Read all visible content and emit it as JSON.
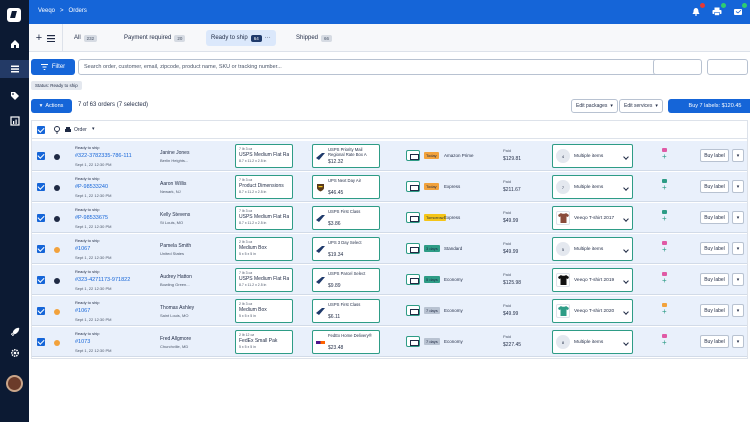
{
  "app": {
    "breadcrumb": [
      "Veeqo",
      ">",
      "Orders"
    ]
  },
  "tabs": [
    {
      "label": "All",
      "count": "232"
    },
    {
      "label": "Payment required",
      "count": "20"
    },
    {
      "label": "Ready to ship",
      "count": "64"
    },
    {
      "label": "Shipped",
      "count": "66"
    }
  ],
  "filter": {
    "button_label": "Filter",
    "search_placeholder": "Search order, customer, email, zipcode, product name, SKU or tracking number...",
    "status_chip": "Status: Ready to ship"
  },
  "actions": {
    "actions_label": "Actions",
    "selection_text": "7 of 63 orders (7 selected)",
    "edit_packages": "Edit packages",
    "edit_services": "Edit services",
    "buy_labels": "Buy 7 labels: $120.45"
  },
  "table_header": {
    "order_label": "Order"
  },
  "colors": {
    "brand": "#1565d8",
    "sidebar": "#0c1a33",
    "accent_green": "#2e9c86"
  },
  "orders": [
    {
      "status": "Ready to ship",
      "number": "#322-3782335-786-111",
      "date": "Sept 1, 22 12:30 PM",
      "channel": "amazon",
      "customer": "Janine Jones",
      "location": "Berlin Heights...",
      "pkg_weight": "7 lb 3 oz",
      "pkg_name": "USPS Medium Flat Rate...",
      "pkg_dims": "8.7 x 11.2 x 2.5 in",
      "carrier": "usps",
      "service": "USPS Priority Mail Regional Rate Box A",
      "price": "$12.32",
      "days": "Today",
      "days_color": "#f2a23c",
      "speed": "Amazon Prime",
      "paid": "Paid",
      "total": "$129.81",
      "item_thumb": "4",
      "item": "Multiple items",
      "tag1": "#e05aa5",
      "tag2": "#2e9c86",
      "buy": "Buy label"
    },
    {
      "status": "Ready to ship",
      "number": "#P-98533240",
      "date": "Sept 1, 22 12:30 PM",
      "channel": "other",
      "customer": "Aaron Willis",
      "location": "Newark, NJ",
      "pkg_weight": "7 lb 3 oz",
      "pkg_name": "Product Dimensions",
      "pkg_dims": "8.7 x 11.2 x 2.5 in",
      "carrier": "ups",
      "service": "UPS Next Day Air",
      "price": "$46.45",
      "days": "Today",
      "days_color": "#f2a23c",
      "speed": "Express",
      "paid": "Paid",
      "total": "$211.67",
      "item_thumb": "7",
      "item": "Multiple items",
      "tag1": "#2e9c86",
      "tag2": "#2e9c86",
      "buy": "Buy label"
    },
    {
      "status": "Ready to ship",
      "number": "#P-98533675",
      "date": "Sept 1, 22 12:30 PM",
      "channel": "other",
      "customer": "Kelly Stevens",
      "location": "St Louis, MO",
      "pkg_weight": "7 lb 3 oz",
      "pkg_name": "USPS Medium Flat Rate...",
      "pkg_dims": "8.7 x 11.2 x 2.5 in",
      "carrier": "usps",
      "service": "USPS First Class",
      "price": "$3.86",
      "days": "Tomorrow",
      "days_color": "#f5c518",
      "speed": "Express",
      "paid": "Paid",
      "total": "$49.99",
      "item_thumb": "",
      "item": "Veeqo T-shirt 2017",
      "tag1": "#2e9c86",
      "tag2": "#2e9c86",
      "buy": "Buy label"
    },
    {
      "status": "Ready to ship",
      "number": "#1067",
      "date": "Sept 1, 22 12:30 PM",
      "channel": "shopify",
      "customer": "Pamela Smith",
      "location": "United States",
      "pkg_weight": "2 lb 3 oz",
      "pkg_name": "Medium Box",
      "pkg_dims": "5 x 5 x 5 in",
      "carrier": "usps",
      "service": "UPS 3 Day Select",
      "price": "$19.34",
      "days": "3 days",
      "days_color": "#2e9c86",
      "speed": "Standard",
      "paid": "Paid",
      "total": "$49.99",
      "item_thumb": "5",
      "item": "Multiple items",
      "tag1": "#e05aa5",
      "tag2": "#2e9c86",
      "buy": "Buy label"
    },
    {
      "status": "Ready to ship",
      "number": "#323-4271173-971822",
      "date": "Sept 1, 22 12:30 PM",
      "channel": "amazon",
      "customer": "Audrey Hatton",
      "location": "Bowling Green...",
      "pkg_weight": "7 lb 3 oz",
      "pkg_name": "USPS Medium Flat Rate...",
      "pkg_dims": "8.7 x 11.2 x 2.5 in",
      "carrier": "usps",
      "service": "USPS Parcel Select",
      "price": "$9.89",
      "days": "5 days",
      "days_color": "#2e9c86",
      "speed": "Economy",
      "paid": "Paid",
      "total": "$125.98",
      "item_thumb": "",
      "item": "Veeqo T-shirt 2019",
      "tag1": "#e05aa5",
      "tag2": "#2e9c86",
      "buy": "Buy label"
    },
    {
      "status": "Ready to ship",
      "number": "#1067",
      "date": "Sept 1, 22 12:30 PM",
      "channel": "shopify",
      "customer": "Thomas Ashley",
      "location": "Saint Louis, MO",
      "pkg_weight": "2 lb 3 oz",
      "pkg_name": "Medium Box",
      "pkg_dims": "5 x 5 x 5 in",
      "carrier": "usps",
      "service": "USPS First Class",
      "price": "$6.11",
      "days": "7 days",
      "days_color": "#b8c2d1",
      "speed": "Economy",
      "paid": "Paid",
      "total": "$49.99",
      "item_thumb": "",
      "item": "Veeqo T-shirt 2020",
      "tag1": "#f2a23c",
      "tag2": "#2e9c86",
      "buy": "Buy label"
    },
    {
      "status": "Ready to ship",
      "number": "#1073",
      "date": "Sept 1, 22 12:30 PM",
      "channel": "shopify",
      "customer": "Fred Allgmore",
      "location": "Churchville, MD",
      "pkg_weight": "2 lb 12 oz",
      "pkg_name": "FedEx Small Pak",
      "pkg_dims": "5 x 5 x 5 in",
      "carrier": "fedex",
      "service": "FedEx Home Delivery®",
      "price": "$23.48",
      "days": "7 days",
      "days_color": "#b8c2d1",
      "speed": "Economy",
      "paid": "Paid",
      "total": "$227.45",
      "item_thumb": "8",
      "item": "Multiple items",
      "tag1": "#e05aa5",
      "tag2": "#2e9c86",
      "buy": "Buy label"
    }
  ]
}
